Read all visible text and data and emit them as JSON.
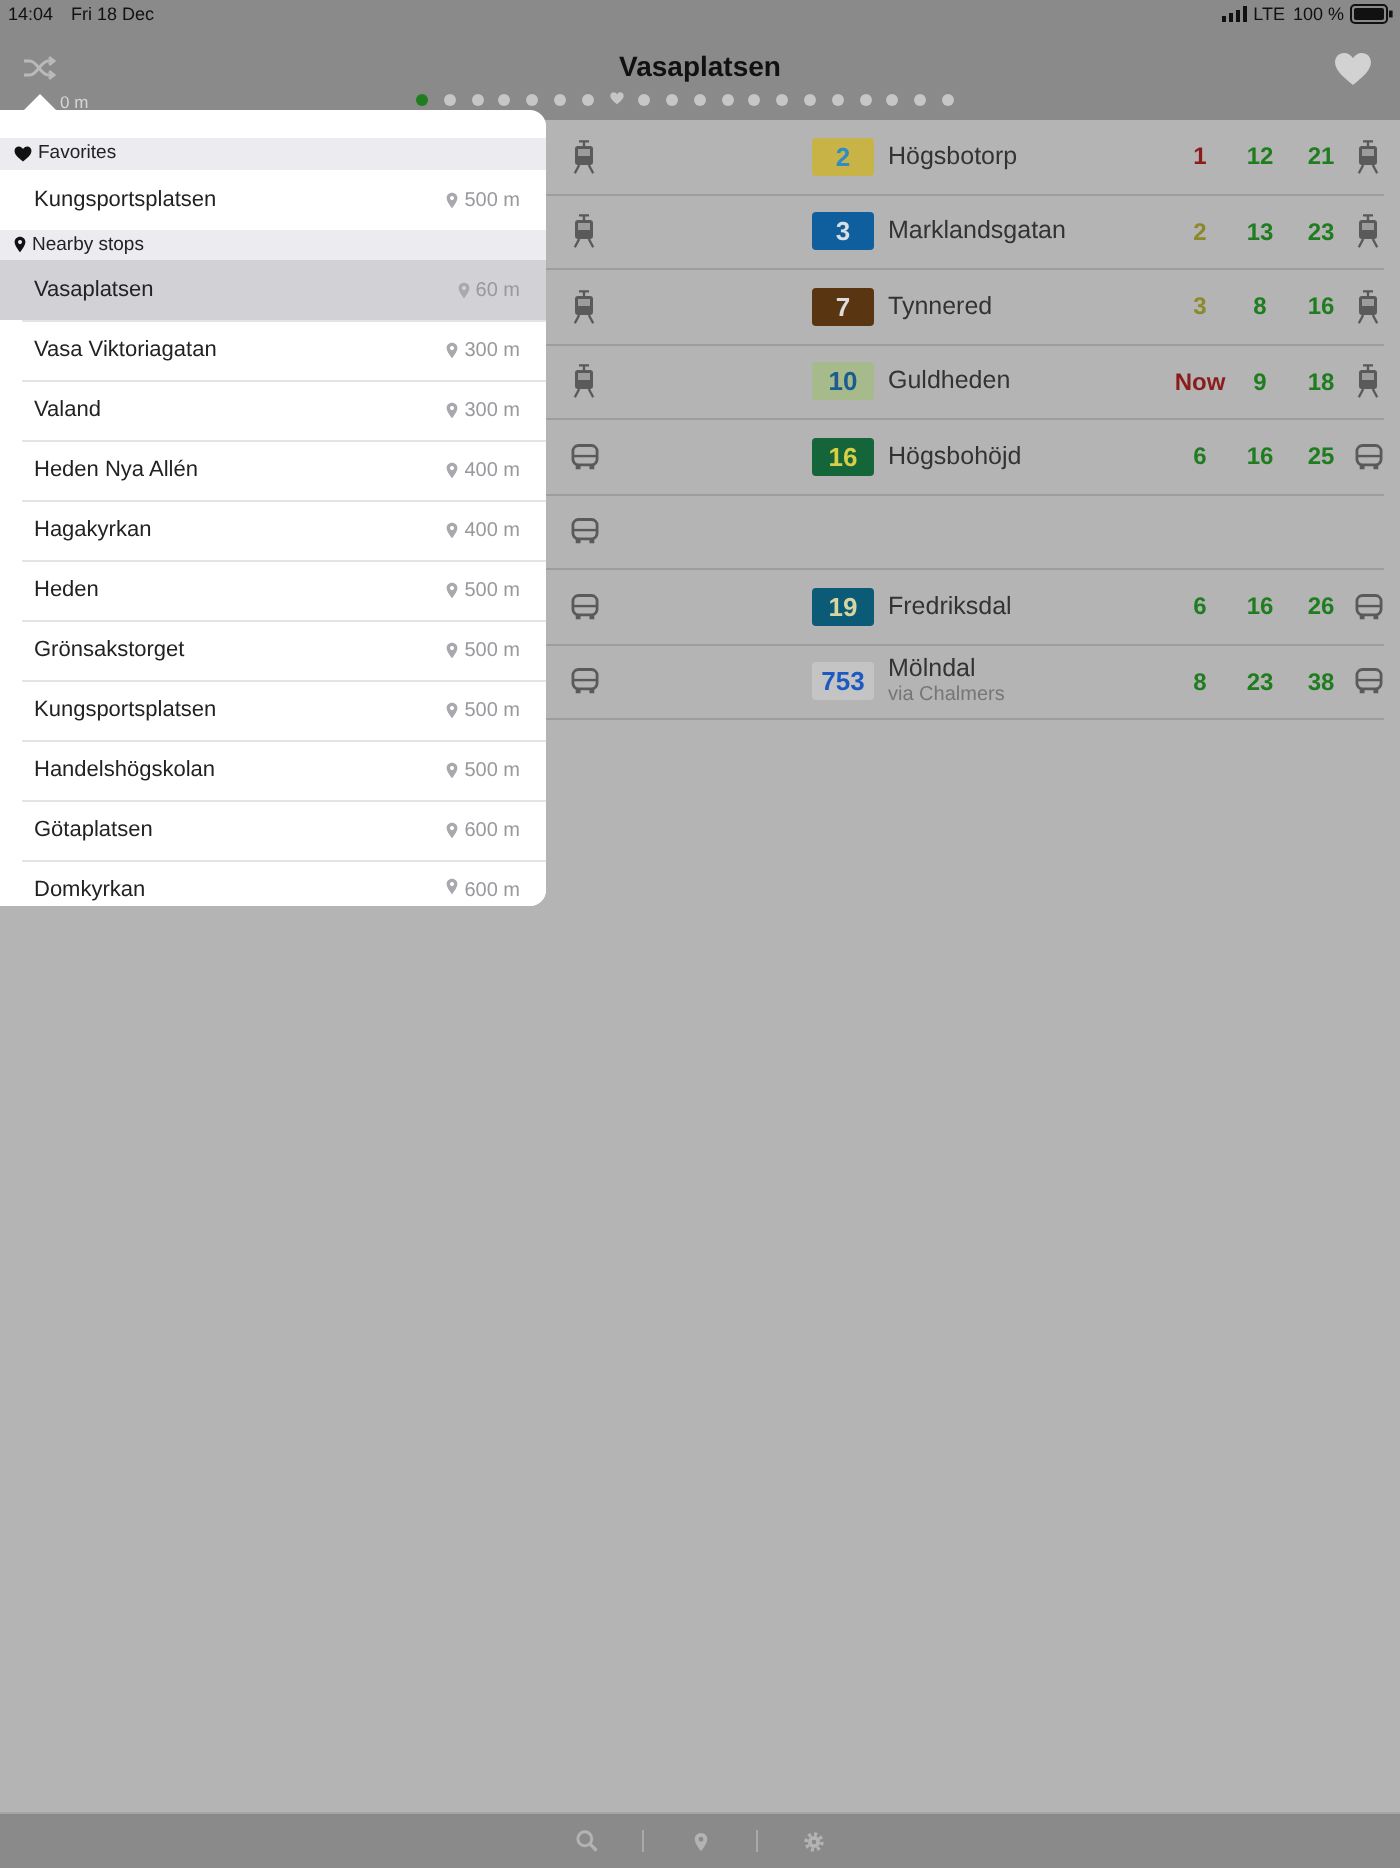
{
  "status_bar": {
    "time": "14:04",
    "date": "Fri 18 Dec",
    "network": "LTE",
    "battery": "100 %"
  },
  "nav_bar": {
    "title": "Vasaplatsen",
    "distance": "0 m",
    "pages": [
      {
        "kind": "dot",
        "selected": true
      },
      {
        "kind": "dot",
        "selected": false
      },
      {
        "kind": "dot",
        "selected": false
      },
      {
        "kind": "dot",
        "selected": false
      },
      {
        "kind": "dot",
        "selected": false
      },
      {
        "kind": "dot",
        "selected": false
      },
      {
        "kind": "dot",
        "selected": false
      },
      {
        "kind": "heart",
        "selected": false
      },
      {
        "kind": "dot",
        "selected": false
      },
      {
        "kind": "dot",
        "selected": false
      },
      {
        "kind": "dot",
        "selected": false
      },
      {
        "kind": "dot",
        "selected": false
      },
      {
        "kind": "dot",
        "selected": false
      },
      {
        "kind": "dot",
        "selected": false
      },
      {
        "kind": "dot",
        "selected": false
      },
      {
        "kind": "dot",
        "selected": false
      },
      {
        "kind": "dot",
        "selected": false
      },
      {
        "kind": "dot",
        "selected": false
      },
      {
        "kind": "dot",
        "selected": false
      },
      {
        "kind": "dot",
        "selected": false
      }
    ]
  },
  "departures": [
    {
      "kind": "tram",
      "line": {
        "color": "#c8b446",
        "label": {
          "text": "2",
          "color": "#2f8cc4"
        }
      },
      "destination": "Högsbotorp",
      "times": [
        {
          "text": "1",
          "color": "#8b1c1c"
        },
        {
          "text": "12",
          "color": "#1f7d1f"
        },
        {
          "text": "21",
          "color": "#1f7d1f"
        }
      ]
    },
    {
      "kind": "tram",
      "line": {
        "color": "#0f5f9f",
        "label": {
          "text": "3",
          "color": "#dadfe4"
        }
      },
      "destination": "Marklandsgatan",
      "times": [
        {
          "text": "2",
          "color": "#8a8a2a"
        },
        {
          "text": "13",
          "color": "#1f7d1f"
        },
        {
          "text": "23",
          "color": "#1f7d1f"
        }
      ]
    },
    {
      "kind": "tram",
      "line": {
        "color": "#5a3512",
        "label": {
          "text": "7",
          "color": "#dcdcdc"
        }
      },
      "destination": "Tynnered",
      "times": [
        {
          "text": "3",
          "color": "#8a8a2a"
        },
        {
          "text": "8",
          "color": "#1f7d1f"
        },
        {
          "text": "16",
          "color": "#1f7d1f"
        }
      ]
    },
    {
      "kind": "tram",
      "line": {
        "color": "#a6ba8c",
        "label": {
          "text": "10",
          "color": "#1d5c8e"
        }
      },
      "destination": "Guldheden",
      "times": [
        {
          "text": "Now",
          "color": "#8b1c1c"
        },
        {
          "text": "9",
          "color": "#1f7d1f"
        },
        {
          "text": "18",
          "color": "#1f7d1f"
        }
      ]
    },
    {
      "kind": "bus",
      "line": {
        "color": "#15653a",
        "label": {
          "text": "16",
          "color": "#d8d044"
        }
      },
      "destination": "Högsbohöjd",
      "times": [
        {
          "text": "6",
          "color": "#1f7d1f"
        },
        {
          "text": "16",
          "color": "#1f7d1f"
        },
        {
          "text": "25",
          "color": "#1f7d1f"
        }
      ]
    },
    {
      "kind": "bus"
    },
    {
      "kind": "bus",
      "line": {
        "color": "#0b5a76",
        "label": {
          "text": "19",
          "color": "#d8d4a2"
        }
      },
      "destination": "Fredriksdal",
      "times": [
        {
          "text": "6",
          "color": "#1f7d1f"
        },
        {
          "text": "16",
          "color": "#1f7d1f"
        },
        {
          "text": "26",
          "color": "#1f7d1f"
        }
      ]
    },
    {
      "kind": "bus",
      "line": {
        "color": "#c4c4c4",
        "label": {
          "text": "753",
          "color": "#1c5ac2"
        }
      },
      "destination": "Mölndal",
      "via": "via Chalmers",
      "times": [
        {
          "text": "8",
          "color": "#1f7d1f"
        },
        {
          "text": "23",
          "color": "#1f7d1f"
        },
        {
          "text": "38",
          "color": "#1f7d1f"
        }
      ]
    }
  ],
  "popover": {
    "sections": [
      {
        "kind": "favorites",
        "title": "Favorites",
        "stops": [
          {
            "name": "Kungsportsplatsen",
            "distance": "500 m",
            "selected": false
          }
        ]
      },
      {
        "kind": "nearby",
        "title": "Nearby stops",
        "stops": [
          {
            "name": "Vasaplatsen",
            "distance": "60 m",
            "selected": true
          },
          {
            "name": "Vasa Viktoriagatan",
            "distance": "300 m",
            "selected": false
          },
          {
            "name": "Valand",
            "distance": "300 m",
            "selected": false
          },
          {
            "name": "Heden Nya Allén",
            "distance": "400 m",
            "selected": false
          },
          {
            "name": "Hagakyrkan",
            "distance": "400 m",
            "selected": false
          },
          {
            "name": "Heden",
            "distance": "500 m",
            "selected": false
          },
          {
            "name": "Grönsakstorget",
            "distance": "500 m",
            "selected": false
          },
          {
            "name": "Kungsportsplatsen",
            "distance": "500 m",
            "selected": false
          },
          {
            "name": "Handelshögskolan",
            "distance": "500 m",
            "selected": false
          },
          {
            "name": "Götaplatsen",
            "distance": "600 m",
            "selected": false
          },
          {
            "name": "Domkyrkan",
            "distance": "600 m",
            "selected": false
          }
        ]
      }
    ]
  },
  "tab_bar": {
    "items": [
      {
        "kind": "search"
      },
      {
        "kind": "map_pin"
      },
      {
        "kind": "settings"
      }
    ]
  }
}
